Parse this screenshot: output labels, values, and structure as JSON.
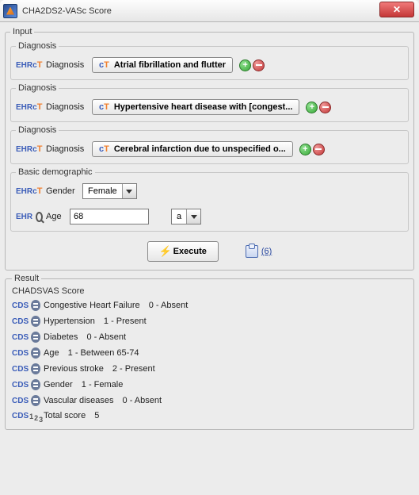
{
  "window": {
    "title": "CHA2DS2-VASc Score"
  },
  "input": {
    "legend": "Input",
    "diagnosis_legend": "Diagnosis",
    "diagnosis_label": "Diagnosis",
    "diagnoses": [
      {
        "text": "Atrial fibrillation and flutter"
      },
      {
        "text": "Hypertensive heart disease with [congest..."
      },
      {
        "text": "Cerebral infarction due to unspecified o..."
      }
    ],
    "demographic": {
      "legend": "Basic demographic",
      "gender_label": "Gender",
      "gender_value": "Female",
      "age_label": "Age",
      "age_value": "68",
      "age_unit": "a"
    },
    "execute_label": "Execute",
    "log_count": "(6)"
  },
  "result": {
    "legend": "Result",
    "score_legend": "CHADSVAS Score",
    "items": [
      {
        "label": "Congestive Heart Failure",
        "value": "0 - Absent"
      },
      {
        "label": "Hypertension",
        "value": "1 - Present"
      },
      {
        "label": "Diabetes",
        "value": "0 - Absent"
      },
      {
        "label": "Age",
        "value": "1 - Between 65-74"
      },
      {
        "label": "Previous stroke",
        "value": "2 - Present"
      },
      {
        "label": "Gender",
        "value": "1 - Female"
      },
      {
        "label": "Vascular diseases",
        "value": "0 - Absent"
      }
    ],
    "total_label": "Total score",
    "total_value": "5"
  }
}
